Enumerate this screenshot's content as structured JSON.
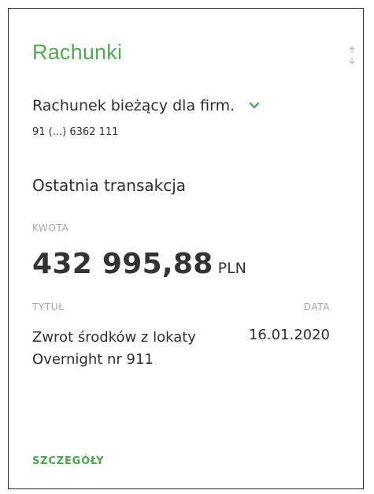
{
  "card": {
    "title": "Rachunki",
    "account": {
      "name": "Rachunek bieżący dla firm.",
      "number": "91 (...) 6362 111"
    },
    "last_transaction": {
      "section_title": "Ostatnia transakcja",
      "amount_label": "KWOTA",
      "amount": "432 995,88",
      "currency": "PLN",
      "title_label": "TYTUŁ",
      "title_value": "Zwrot środków z lokaty Overnight nr 911",
      "date_label": "DATA",
      "date_value": "16.01.2020"
    },
    "details_link": "SZCZEGÓŁY"
  },
  "colors": {
    "accent": "#52a955",
    "label": "#a7a7a7",
    "text": "#2f2f2f",
    "border": "#2b2b2b"
  },
  "icons": [
    "sort-drag-icon",
    "chevron-down-icon"
  ]
}
